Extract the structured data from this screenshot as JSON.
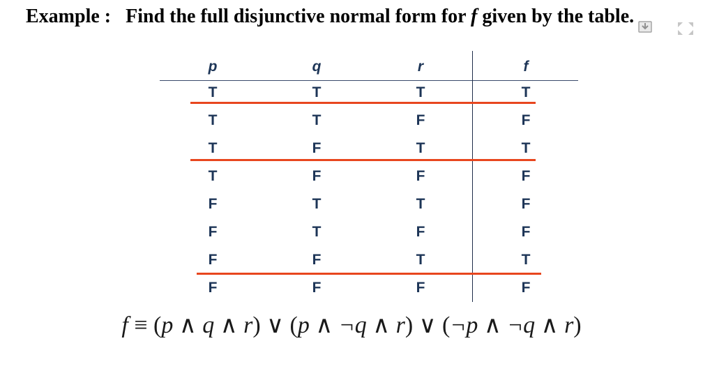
{
  "title": {
    "prefix": "Example :",
    "text_before": "Find the full disjunctive normal form for",
    "fvar": "f",
    "text_after": "given by the table."
  },
  "icons": {
    "download": "download-icon",
    "fullscreen": "fullscreen-icon"
  },
  "table": {
    "headers": [
      "p",
      "q",
      "r",
      "f"
    ],
    "rows": [
      [
        "T",
        "T",
        "T",
        "T"
      ],
      [
        "T",
        "T",
        "F",
        "F"
      ],
      [
        "T",
        "F",
        "T",
        "T"
      ],
      [
        "T",
        "F",
        "F",
        "F"
      ],
      [
        "F",
        "T",
        "T",
        "F"
      ],
      [
        "F",
        "T",
        "F",
        "F"
      ],
      [
        "F",
        "F",
        "T",
        "T"
      ],
      [
        "F",
        "F",
        "F",
        "F"
      ]
    ],
    "highlighted_rows": [
      0,
      2,
      6
    ]
  },
  "formula": {
    "lhs": "f",
    "terms": [
      {
        "p": "p",
        "q": "q",
        "r": "r"
      },
      {
        "p": "p",
        "q": "¬q",
        "r": "r"
      },
      {
        "p": "¬p",
        "q": "¬q",
        "r": "r"
      }
    ]
  },
  "colors": {
    "text": "#1d3557",
    "highlight": "#e8461e",
    "rule": "#1e2d4a"
  }
}
